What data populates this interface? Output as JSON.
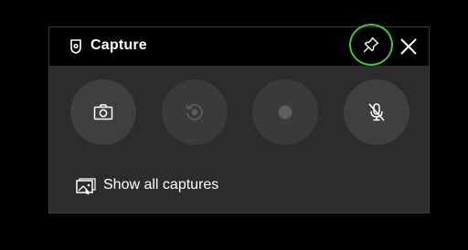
{
  "widget": {
    "title": "Capture",
    "title_icon": "capture-widget-icon",
    "pin_icon": "pin-icon",
    "close_icon": "close-icon"
  },
  "buttons": [
    {
      "name": "screenshot-button",
      "icon": "camera-icon",
      "enabled": true
    },
    {
      "name": "record-last-button",
      "icon": "record-last-30s-icon",
      "enabled": false
    },
    {
      "name": "start-recording-button",
      "icon": "record-dot-icon",
      "enabled": false
    },
    {
      "name": "microphone-toggle-button",
      "icon": "mic-off-icon",
      "enabled": true
    }
  ],
  "footer": {
    "show_all_label": "Show all captures",
    "show_all_icon": "gallery-icon"
  },
  "colors": {
    "background": "#000000",
    "panel": "#2c2c2c",
    "title_bar": "#000000",
    "button": "#3f3f3f",
    "button_disabled": "#3a3a3a",
    "highlight_ring": "#45c23c",
    "text": "#ffffff",
    "disabled_icon": "#5e5e5e"
  }
}
